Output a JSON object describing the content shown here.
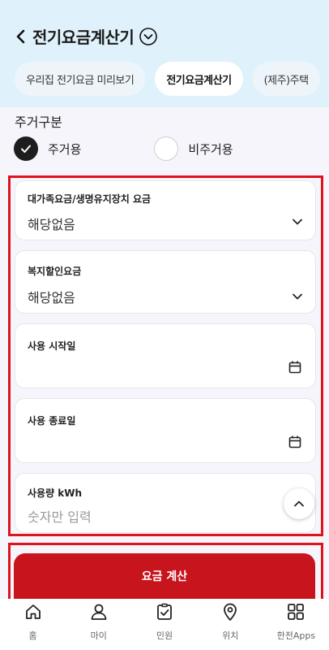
{
  "header": {
    "title": "전기요금계산기",
    "tabs": [
      {
        "label": "우리집 전기요금 미리보기",
        "active": false
      },
      {
        "label": "전기요금계산기",
        "active": true
      },
      {
        "label": "(제주)주택",
        "active": false
      }
    ]
  },
  "form": {
    "residence_label": "주거구분",
    "residence_options": [
      {
        "label": "주거용",
        "selected": true
      },
      {
        "label": "비주거용",
        "selected": false
      }
    ],
    "fields": [
      {
        "label": "대가족요금/생명유지장치 요금",
        "value": "해당없음",
        "icon": "chevron-down-icon"
      },
      {
        "label": "복지할인요금",
        "value": "해당없음",
        "icon": "chevron-down-icon"
      },
      {
        "label": "사용 시작일",
        "value": "",
        "icon": "calendar-icon"
      },
      {
        "label": "사용 종료일",
        "value": "",
        "icon": "calendar-icon"
      },
      {
        "label": "사용량 kWh",
        "placeholder": "숫자만 입력"
      }
    ],
    "submit_label": "요금 계산"
  },
  "bottom_nav": [
    {
      "label": "홈",
      "icon": "home-icon"
    },
    {
      "label": "마이",
      "icon": "user-icon"
    },
    {
      "label": "민원",
      "icon": "clipboard-check-icon"
    },
    {
      "label": "위치",
      "icon": "location-pin-icon"
    },
    {
      "label": "한전Apps",
      "icon": "apps-grid-icon"
    }
  ],
  "colors": {
    "header_bg": "#dff2fb",
    "accent_red": "#c8141c",
    "highlight_border": "#e0131c"
  }
}
